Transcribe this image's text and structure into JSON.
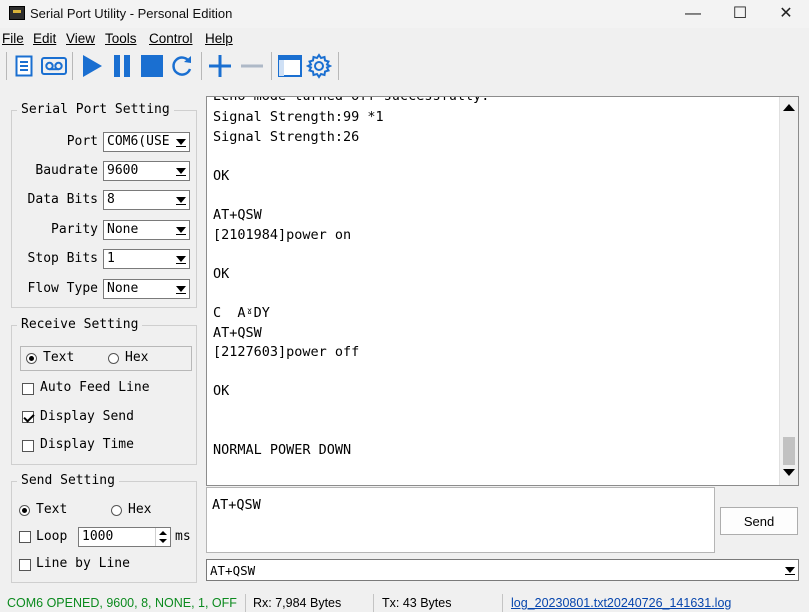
{
  "window": {
    "title": "Serial Port Utility - Personal Edition",
    "controls": [
      "—",
      "☐",
      "✕"
    ]
  },
  "menu": [
    "File",
    "Edit",
    "View",
    "Tools",
    "Control",
    "Help"
  ],
  "toolbar": {
    "icons": [
      "document-icon",
      "record-icon",
      "play-icon",
      "pause-icon",
      "stop-icon",
      "refresh-icon",
      "add-icon",
      "remove-icon",
      "window-icon",
      "settings-icon"
    ],
    "accent": "#1a6fd1"
  },
  "serial_port_setting": {
    "title": "Serial Port Setting",
    "fields": [
      {
        "label": "Port",
        "value": "COM6(USE"
      },
      {
        "label": "Baudrate",
        "value": "9600"
      },
      {
        "label": "Data Bits",
        "value": "8"
      },
      {
        "label": "Parity",
        "value": "None"
      },
      {
        "label": "Stop Bits",
        "value": "1"
      },
      {
        "label": "Flow Type",
        "value": "None"
      }
    ]
  },
  "receive_setting": {
    "title": "Receive Setting",
    "mode_options": [
      {
        "label": "Text",
        "selected": true
      },
      {
        "label": "Hex",
        "selected": false
      }
    ],
    "auto_feed_line": {
      "label": "Auto Feed Line",
      "checked": false
    },
    "display_send": {
      "label": "Display Send",
      "checked": true
    },
    "display_time": {
      "label": "Display Time",
      "checked": false
    }
  },
  "send_setting": {
    "title": "Send Setting",
    "mode_options": [
      {
        "label": "Text",
        "selected": true
      },
      {
        "label": "Hex",
        "selected": false
      }
    ],
    "loop": {
      "label": "Loop",
      "checked": false,
      "value": "1000",
      "unit": "ms"
    },
    "line_by_line": {
      "label": "Line by Line",
      "checked": false
    }
  },
  "receive_area": {
    "partial_top_line": "Echo mode turned off successfully.",
    "lines": [
      "Signal Strength:99 *1",
      "Signal Strength:26",
      "",
      "OK",
      "",
      "AT+QSW",
      "[2101984]power on",
      "",
      "OK",
      "",
      "C  AˠDY",
      "AT+QSW",
      "[2127603]power off",
      "",
      "OK",
      "",
      "",
      "NORMAL POWER DOWN"
    ]
  },
  "send_area": {
    "text": "AT+QSW",
    "button_label": "Send",
    "history_value": "AT+QSW"
  },
  "status_bar": {
    "port_status": "COM6 OPENED, 9600, 8, NONE, 1, OFF",
    "port_status_color": "#0b8a1e",
    "rx": "Rx: 7,984 Bytes",
    "tx": "Tx: 43 Bytes",
    "log_file": "log_20230801.txt20240726_141631.log",
    "log_color": "#0645ad"
  }
}
